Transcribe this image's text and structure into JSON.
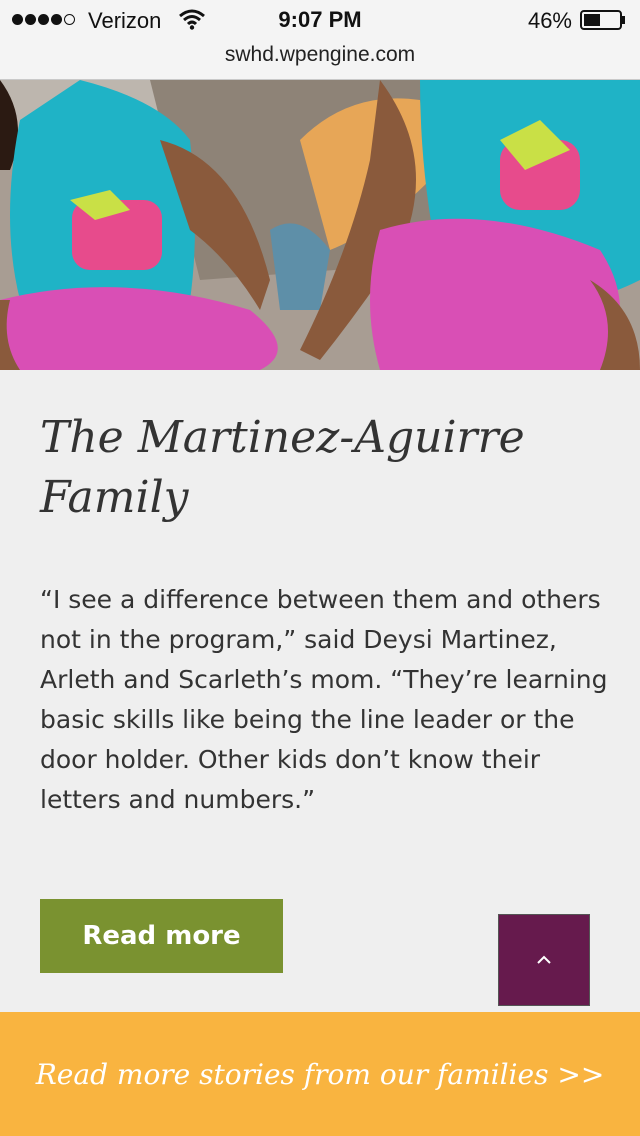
{
  "status_bar": {
    "carrier": "Verizon",
    "time": "9:07 PM",
    "battery_percent": "46%",
    "signal_icon": "signal-dots-icon",
    "wifi_icon": "wifi-icon",
    "battery_icon": "battery-icon"
  },
  "browser": {
    "url": "swhd.wpengine.com"
  },
  "story": {
    "title": "The Martinez-Aguirre Family",
    "quote": "“I see a difference between them and others not in the program,” said Deysi Martinez, Arleth and Scarleth’s mom. “They’re learning basic skills like being the line leader or the door holder. Other kids don’t know their letters and numbers.”",
    "read_more_label": "Read more"
  },
  "back_to_top": {
    "icon": "chevron-up-icon"
  },
  "footer": {
    "link_text": "Read more stories from our families >>"
  },
  "colors": {
    "page_background": "#efefef",
    "button_green": "#7a9230",
    "back_to_top_purple": "#661a4d",
    "footer_orange": "#f9b440",
    "text_dark": "#333333",
    "photo_shirt_turquoise": "#1fb3c6",
    "photo_pants_magenta": "#d94fb5"
  }
}
